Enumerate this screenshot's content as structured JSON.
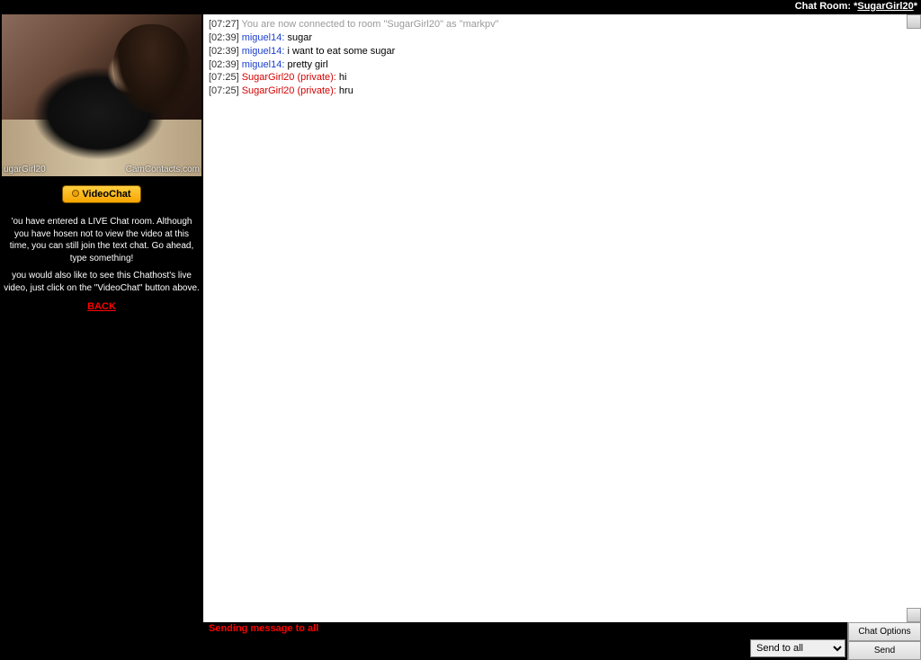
{
  "header": {
    "label": "Chat Room: ",
    "prefix": "*",
    "room_name": "SugarGirl20"
  },
  "sidebar": {
    "watermark_left": "ugarGirl20",
    "watermark_right": "CamContacts.com",
    "videochat_label": "VideoChat",
    "info1": "'ou have entered a LIVE Chat room. Although you have hosen not to view the video at this time, you can still join the text chat. Go ahead, type something!",
    "info2": "you would also like to see this Chathost's live video, just click on the \"VideoChat\" button above.",
    "back_label": "BACK"
  },
  "chat": {
    "messages": [
      {
        "time": "[07:27]",
        "user": "",
        "user_class": "sys",
        "text": "You are now connected to room \"SugarGirl20\" as \"markpv\"",
        "text_class": "sys"
      },
      {
        "time": "[02:39]",
        "user": "miguel14:",
        "user_class": "user-blue",
        "text": "sugar",
        "text_class": ""
      },
      {
        "time": "[02:39]",
        "user": "miguel14:",
        "user_class": "user-blue",
        "text": "i want to eat some sugar",
        "text_class": ""
      },
      {
        "time": "[02:39]",
        "user": "miguel14:",
        "user_class": "user-blue",
        "text": "pretty girl",
        "text_class": ""
      },
      {
        "time": "[07:25]",
        "user": "SugarGirl20 (private):",
        "user_class": "user-red",
        "text": "hi",
        "text_class": ""
      },
      {
        "time": "[07:25]",
        "user": "SugarGirl20 (private):",
        "user_class": "user-red",
        "text": "hru",
        "text_class": ""
      }
    ]
  },
  "status": {
    "text": "Sending message to all"
  },
  "input": {
    "target_options": [
      "Send to all"
    ],
    "target_selected": "Send to all"
  },
  "buttons": {
    "chat_options": "Chat Options",
    "send": "Send"
  }
}
